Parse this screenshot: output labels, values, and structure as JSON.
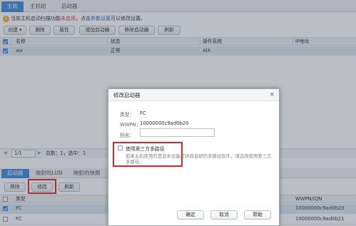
{
  "tabs": [
    {
      "label": "主机"
    },
    {
      "label": "主机组"
    },
    {
      "label": "启动器"
    }
  ],
  "notice": {
    "prefix": "当前主机启动扫描功能",
    "status": "未启用",
    "middle": "，点击",
    "link": "参数设置",
    "suffix": "可以修改设置。"
  },
  "toolbar": {
    "create": "创建",
    "create_arrow": "▾",
    "delete": "删除",
    "properties": "属性",
    "add_initiator": "增加启动器",
    "remove_initiator": "移除启动器",
    "refresh": "刷新"
  },
  "grid": {
    "headers": [
      "名称",
      "状态",
      "操作系统",
      "IP地址"
    ],
    "rows": [
      {
        "name": "aix",
        "status": "正常",
        "os": "AIX",
        "ip": ""
      }
    ]
  },
  "pager": {
    "page": "1/1",
    "total": "总数：1，选中：1"
  },
  "bottom_tabs": [
    {
      "label": "启动器"
    },
    {
      "label": "映射的LUN"
    },
    {
      "label": "映射的快照"
    }
  ],
  "bottom_toolbar": {
    "remove": "移除",
    "modify": "修改",
    "refresh": "刷新"
  },
  "bottom_grid": {
    "headers": [
      "类型",
      "WWPN/IQN"
    ],
    "rows": [
      {
        "type": "FC",
        "wwpn": "10000000c9ad0b20",
        "checked": true
      },
      {
        "type": "FC",
        "wwpn": "10000000c9ad0b21",
        "checked": false
      }
    ]
  },
  "dialog": {
    "title": "修改启动器",
    "close": "×",
    "type_label": "类型：",
    "type_value": "FC",
    "wwpn_label": "WWPN：",
    "wwpn_value": "10000000c9ad0b20",
    "alias_label": "别名：",
    "alias_value": "",
    "thirdparty_label": "使用第三方多路径",
    "thirdparty_hint": "如果主机使用的是非本设备提供商自研的多路径软件，请选择使用第三方多路径。",
    "ok": "确定",
    "cancel": "取消",
    "help": "帮助"
  },
  "colors": {
    "accent": "#3d8be0",
    "highlight": "#e0242b",
    "warning": "#f5a623"
  }
}
